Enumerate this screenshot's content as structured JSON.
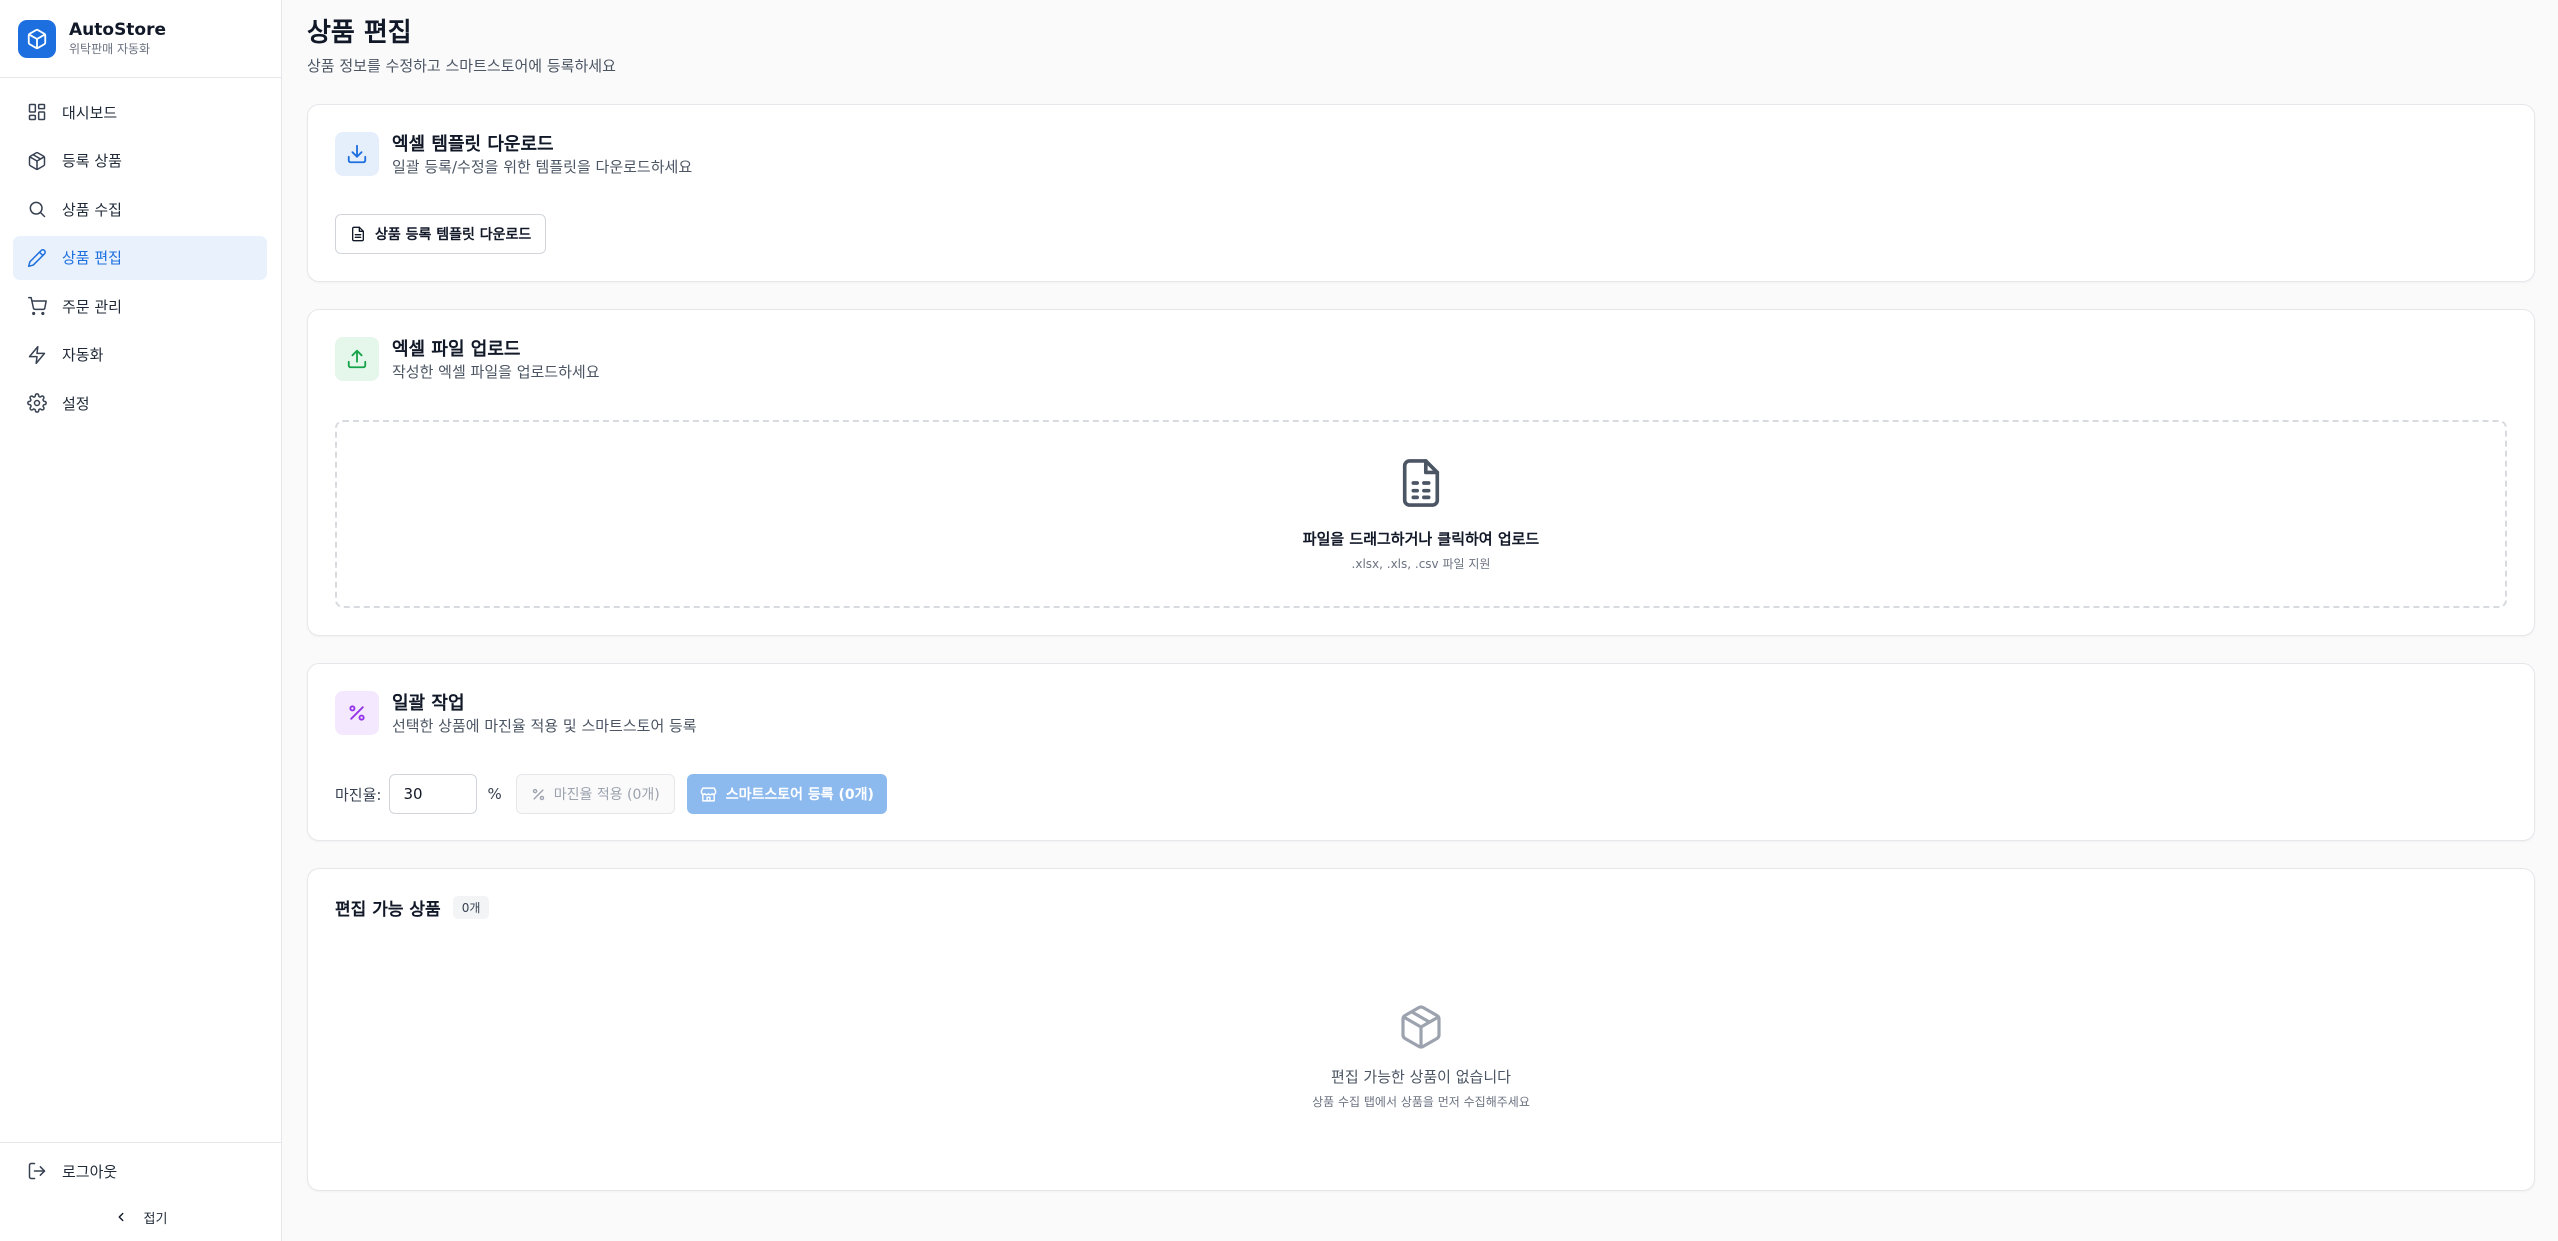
{
  "app": {
    "name": "AutoStore",
    "subtitle": "위탁판매 자동화"
  },
  "sidebar": {
    "items": [
      {
        "label": "대시보드",
        "icon": "dashboard-icon",
        "active": false
      },
      {
        "label": "등록 상품",
        "icon": "package-icon",
        "active": false
      },
      {
        "label": "상품 수집",
        "icon": "search-icon",
        "active": false
      },
      {
        "label": "상품 편집",
        "icon": "pencil-icon",
        "active": true
      },
      {
        "label": "주문 관리",
        "icon": "cart-icon",
        "active": false
      },
      {
        "label": "자동화",
        "icon": "lightning-icon",
        "active": false
      },
      {
        "label": "설정",
        "icon": "gear-icon",
        "active": false
      }
    ],
    "logout_label": "로그아웃",
    "collapse_label": "접기"
  },
  "page": {
    "title": "상품 편집",
    "subtitle": "상품 정보를 수정하고 스마트스토어에 등록하세요"
  },
  "template_card": {
    "title": "엑셀 템플릿 다운로드",
    "description": "일괄 등록/수정을 위한 템플릿을 다운로드하세요",
    "button_label": "상품 등록 템플릿 다운로드"
  },
  "upload_card": {
    "title": "엑셀 파일 업로드",
    "description": "작성한 엑셀 파일을 업로드하세요",
    "dropzone_title": "파일을 드래그하거나 클릭하여 업로드",
    "dropzone_hint": ".xlsx, .xls, .csv 파일 지원"
  },
  "bulk_card": {
    "title": "일괄 작업",
    "description": "선택한 상품에 마진율 적용 및 스마트스토어 등록",
    "margin_label": "마진율:",
    "margin_value": "30",
    "percent_sign": "%",
    "apply_button": "마진율 적용 (0개)",
    "register_button": "스마트스토어 등록 (0개)"
  },
  "products_card": {
    "title": "편집 가능 상품",
    "count_badge": "0개",
    "empty_title": "편집 가능한 상품이 없습니다",
    "empty_hint": "상품 수집 탭에서 상품을 먼저 수집해주세요"
  },
  "colors": {
    "accent": "#1d6fe0",
    "accent_light": "#e8f1fc",
    "green": "#16a34a",
    "purple": "#9333ea",
    "disabled_primary": "#8dbaee"
  }
}
